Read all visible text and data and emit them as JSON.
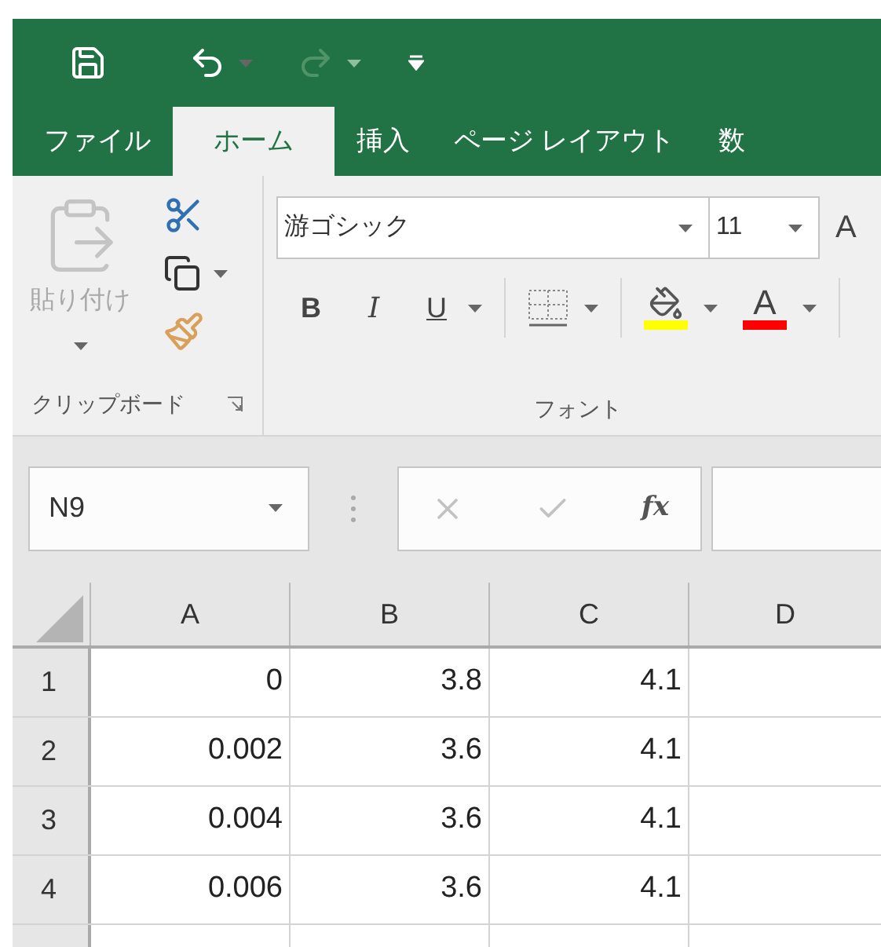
{
  "quick_access": {
    "undo_enabled": true,
    "redo_enabled": false
  },
  "tabs": [
    {
      "label": "ファイル",
      "selected": false
    },
    {
      "label": "ホーム",
      "selected": true
    },
    {
      "label": "挿入",
      "selected": false
    },
    {
      "label": "ページ レイアウト",
      "selected": false
    },
    {
      "label": "数",
      "selected": false
    }
  ],
  "clipboard": {
    "paste_label": "貼り付け",
    "group_label": "クリップボード"
  },
  "font": {
    "name": "游ゴシック",
    "size": "11",
    "grow_glyph": "A",
    "format_buttons": [
      "B",
      "I",
      "U"
    ],
    "font_color_glyph": "A",
    "group_label": "フォント"
  },
  "name_box": "N9",
  "formula_bar": {
    "function_label": "fx"
  },
  "columns": [
    "A",
    "B",
    "C",
    "D"
  ],
  "rows": [
    {
      "header": "1",
      "cells": [
        "0",
        "3.8",
        "4.1"
      ]
    },
    {
      "header": "2",
      "cells": [
        "0.002",
        "3.6",
        "4.1"
      ]
    },
    {
      "header": "3",
      "cells": [
        "0.004",
        "3.6",
        "4.1"
      ]
    },
    {
      "header": "4",
      "cells": [
        "0.006",
        "3.6",
        "4.1"
      ]
    }
  ]
}
